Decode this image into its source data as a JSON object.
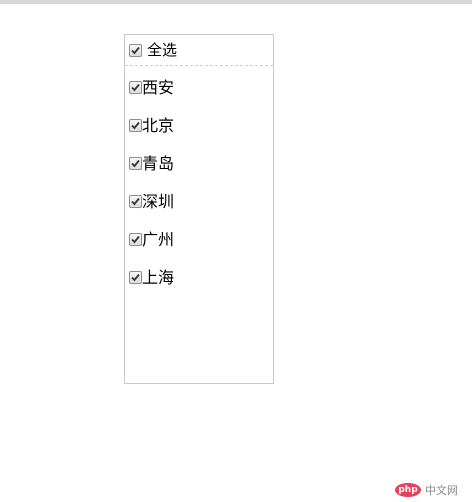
{
  "select_all": {
    "label": "全选",
    "checked": true
  },
  "cities": [
    {
      "label": "西安",
      "checked": true
    },
    {
      "label": "北京",
      "checked": true
    },
    {
      "label": "青岛",
      "checked": true
    },
    {
      "label": "深圳",
      "checked": true
    },
    {
      "label": "广州",
      "checked": true
    },
    {
      "label": "上海",
      "checked": true
    }
  ],
  "watermark": {
    "logo": "php",
    "text": "中文网"
  }
}
